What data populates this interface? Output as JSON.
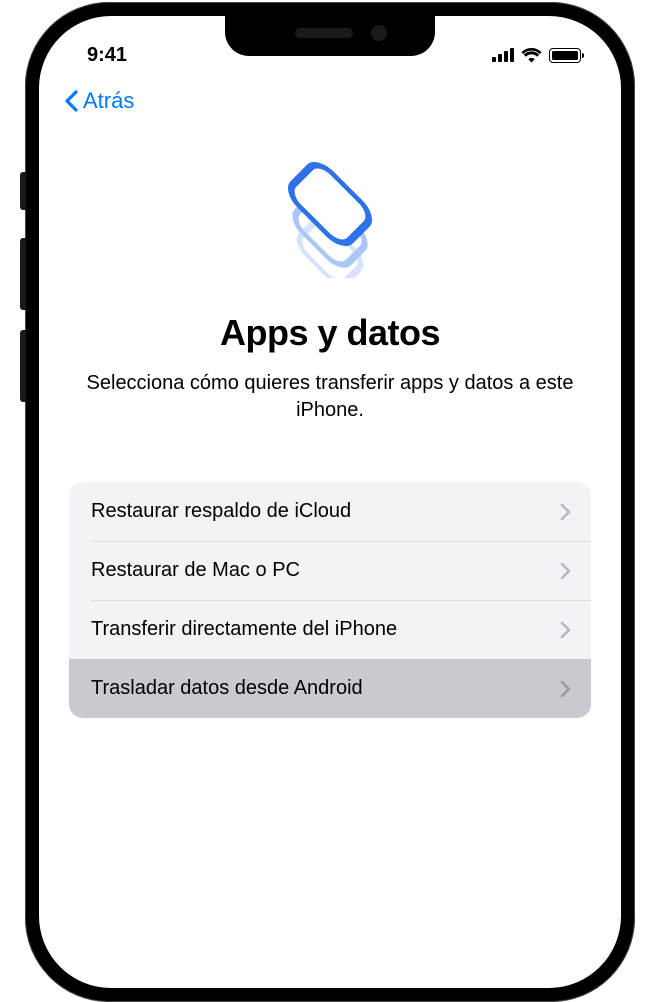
{
  "status": {
    "time": "9:41"
  },
  "nav": {
    "back_label": "Atrás"
  },
  "page": {
    "title": "Apps y datos",
    "subtitle": "Selecciona cómo quieres transferir apps y datos a este iPhone."
  },
  "options": [
    {
      "label": "Restaurar respaldo de iCloud",
      "selected": false
    },
    {
      "label": "Restaurar de Mac o PC",
      "selected": false
    },
    {
      "label": "Transferir directamente del iPhone",
      "selected": false
    },
    {
      "label": "Trasladar datos desde Android",
      "selected": true
    }
  ],
  "colors": {
    "accent": "#007aff",
    "list_bg": "#f2f2f7",
    "selected_bg": "#c9c9cf"
  }
}
